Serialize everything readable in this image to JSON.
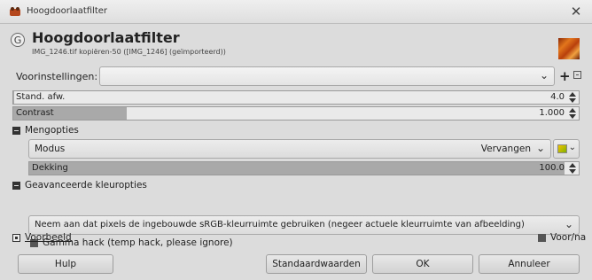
{
  "window": {
    "title": "Hoogdoorlaatfilter",
    "header_title": "Hoogdoorlaatfilter",
    "header_subtitle": "IMG_1246.tif kopiëren-50 ([IMG_1246] (geïmporteerd))"
  },
  "presets": {
    "label": "Voorinstellingen:",
    "value": ""
  },
  "params": {
    "std_dev": {
      "label": "Stand. afw.",
      "value": "4.0",
      "fill": 0.004
    },
    "contrast": {
      "label": "Contrast",
      "value": "1.000",
      "fill": 0.2
    }
  },
  "blending": {
    "section_label": "Mengopties",
    "mode_label": "Modus",
    "mode_value": "Vervangen",
    "opacity": {
      "label": "Dekking",
      "value": "100.0",
      "fill": 1.0
    }
  },
  "advanced": {
    "section_label": "Geavanceerde kleuropties",
    "colorspace_option": "Neem aan dat pixels de ingebouwde sRGB-kleurruimte gebruiken (negeer actuele kleurruimte van afbeelding)",
    "gamma_hack": "Gamma hack (temp hack, please ignore)"
  },
  "preview": {
    "label": "Voorbeeld",
    "split_label": "Voor/na"
  },
  "buttons": {
    "help": "Hulp",
    "defaults": "Standaardwaarden",
    "ok": "OK",
    "cancel": "Annuleer"
  },
  "icons": {
    "app": "gimp-app-icon",
    "close": "close-icon",
    "add_preset": "plus-icon",
    "preset_menu": "menu-icon",
    "dropdown": "chevron-down-icon",
    "spin": "spin-arrows-icon",
    "swatch": "color-swatch-icon"
  }
}
